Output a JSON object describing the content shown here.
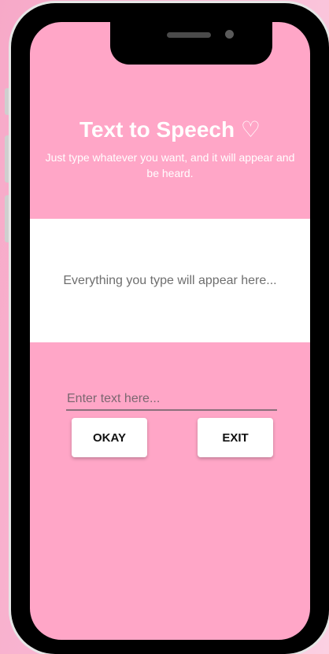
{
  "app": {
    "title": "Text to Speech ♡",
    "subtitle": "Just type whatever you want, and it will appear and be heard."
  },
  "display": {
    "placeholder_text": "Everything you type will appear here..."
  },
  "input": {
    "value": "",
    "placeholder": "Enter text here..."
  },
  "buttons": {
    "okay_label": "OKAY",
    "exit_label": "EXIT"
  },
  "colors": {
    "screen_background": "#ffa6c7",
    "display_background": "#ffffff",
    "button_background": "#ffffff",
    "text_light": "#ffffff"
  },
  "icons": {
    "title_heart": "heart-outline-icon"
  }
}
